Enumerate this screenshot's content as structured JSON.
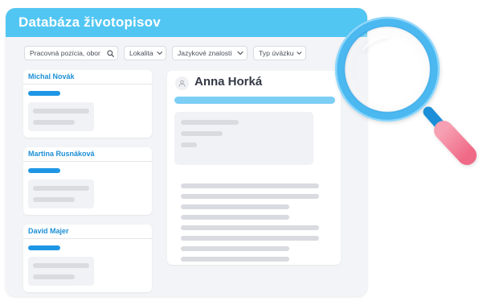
{
  "header": {
    "title": "Databáza životopisov"
  },
  "filters": {
    "search_label": "Pracovná pozícia, obor",
    "location_label": "Lokalita",
    "languages_label": "Jazykové znalosti",
    "job_type_label": "Typ úväzku"
  },
  "candidates": [
    {
      "name": "Michal Novák"
    },
    {
      "name": "Martina Rusnáková"
    },
    {
      "name": "David Majer"
    }
  ],
  "detail": {
    "name": "Anna Horká"
  },
  "colors": {
    "header": "#52c6f3",
    "accent": "#1f96e5",
    "candidate_name": "#1c8fd6",
    "detail_bar": "#7ccef4",
    "magnifier_handle": "#f2788f"
  },
  "icons": {
    "search": "search-icon",
    "dropdown": "chevron-down-icon",
    "avatar": "user-icon",
    "decoration": "magnifying-glass-icon"
  }
}
